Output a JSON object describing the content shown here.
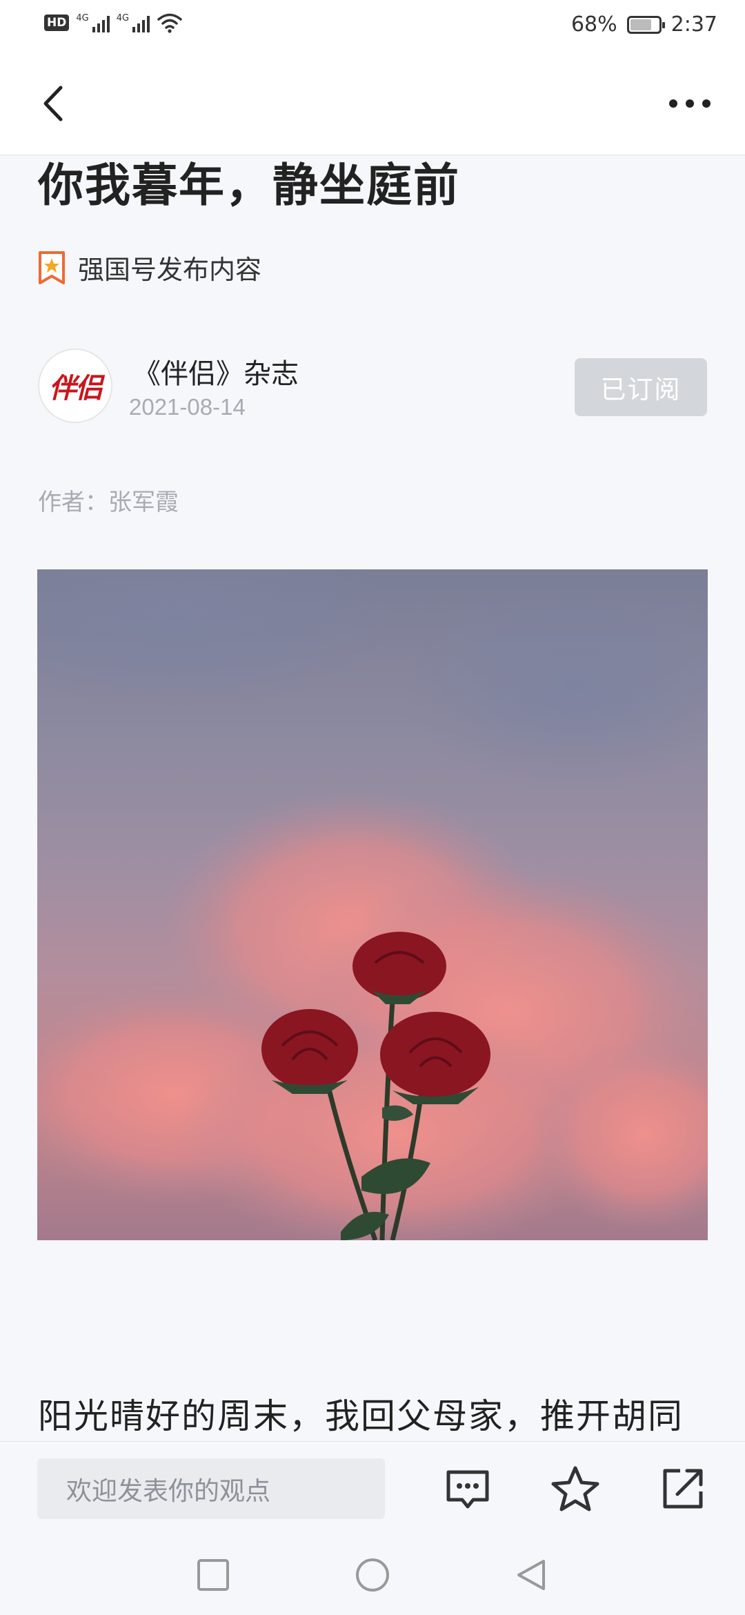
{
  "status_bar": {
    "hd_label": "HD",
    "network1": "4G",
    "network2": "4G",
    "battery_percent": "68%",
    "battery_level": 0.68,
    "time": "2:37"
  },
  "header": {
    "back_icon": "chevron-left-icon",
    "more_icon": "more-dots-icon"
  },
  "article": {
    "title": "你我暮年，静坐庭前",
    "source_label": "强国号发布内容",
    "publisher": {
      "avatar_text": "伴侣",
      "name": "《伴侣》杂志",
      "date": "2021-08-14",
      "subscribe_label": "已订阅"
    },
    "byline": "作者：张军霞",
    "first_paragraph": "阳光晴好的周末，我回父母家，推开胡同"
  },
  "action_bar": {
    "comment_placeholder": "欢迎发表你的观点",
    "icons": [
      "comment-icon",
      "star-icon",
      "share-icon"
    ]
  },
  "nav_bar": {
    "icons": [
      "recents-square-icon",
      "home-circle-icon",
      "back-triangle-icon"
    ]
  },
  "colors": {
    "background": "#f6f7fb",
    "subscribed_button": "#d3d6db",
    "muted_text": "#a7abb2",
    "avatar_red": "#c8161d"
  }
}
